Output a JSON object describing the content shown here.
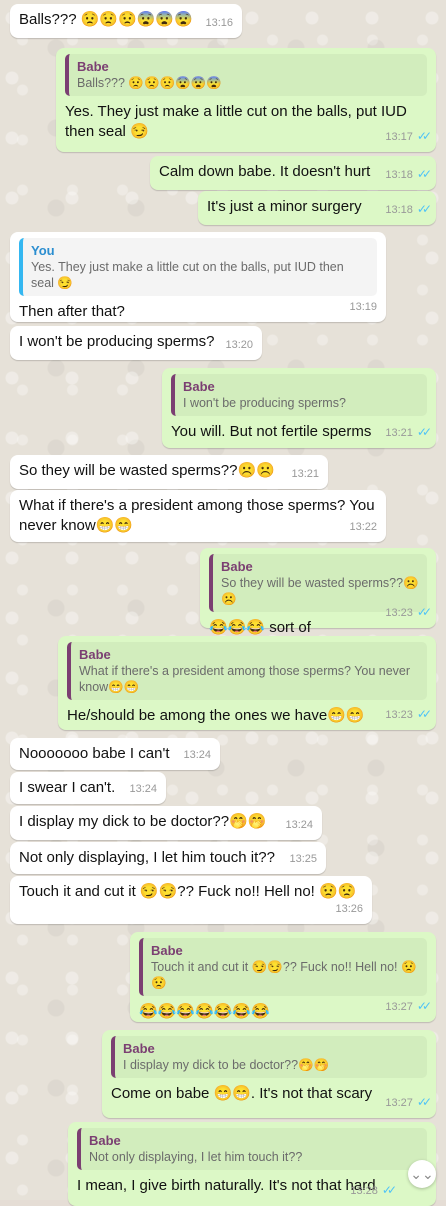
{
  "messages": {
    "m1": {
      "text": "Balls??? 😟😟😟😨😨😨",
      "time": "13:16"
    },
    "m2": {
      "quote_name": "Babe",
      "quote_text": "Balls??? 😟😟😟😨😨😨",
      "text": "Yes. They just make a little cut on the balls, put IUD then seal 😏",
      "time": "13:17"
    },
    "m3": {
      "text": "Calm down babe. It doesn't hurt",
      "time": "13:18"
    },
    "m4": {
      "text": "It's just a minor surgery",
      "time": "13:18"
    },
    "m5": {
      "quote_name": "You",
      "quote_text": "Yes. They just make a little cut on the balls, put IUD then seal 😏",
      "text": "Then after that?",
      "time": "13:19"
    },
    "m6": {
      "text": "I won't be producing sperms?",
      "time": "13:20"
    },
    "m7": {
      "quote_name": "Babe",
      "quote_text": "I won't be producing sperms?",
      "text": "You will. But not fertile sperms",
      "time": "13:21"
    },
    "m8": {
      "text": "So they will be wasted sperms??☹️☹️",
      "time": "13:21"
    },
    "m9": {
      "text": "What if there's a president among those sperms? You never know😁😁",
      "time": "13:22"
    },
    "m10": {
      "quote_name": "Babe",
      "quote_text": "So they will be wasted sperms??☹️☹️",
      "text": "😂😂😂 sort of",
      "time": "13:23"
    },
    "m11": {
      "quote_name": "Babe",
      "quote_text": "What if there's a president among those sperms? You never know😁😁",
      "text": "He/should be among the ones we have😁😁",
      "time": "13:23"
    },
    "m12": {
      "text": "Nooooooo babe I can't",
      "time": "13:24"
    },
    "m13": {
      "text": "I swear I can't.",
      "time": "13:24"
    },
    "m14": {
      "text": "I display my dick to be doctor??🤭🤭",
      "time": "13:24"
    },
    "m15": {
      "text": "Not only displaying, I let him touch it??",
      "time": "13:25"
    },
    "m16": {
      "text": "Touch it and cut it 😏😏?? Fuck no!! Hell no! 😟😟",
      "time": "13:26"
    },
    "m17": {
      "quote_name": "Babe",
      "quote_text": "Touch it and cut it 😏😏?? Fuck no!! Hell no! 😟😟",
      "text": "😂😂😂😂😂😂😂",
      "time": "13:27"
    },
    "m18": {
      "quote_name": "Babe",
      "quote_text": "I display my dick to be doctor??🤭🤭",
      "text": "Come on babe 😁😁. It's not that scary",
      "time": "13:27"
    },
    "m19": {
      "quote_name": "Babe",
      "quote_text": "Not only displaying, I let him touch it??",
      "text": "I mean, I give birth naturally. It's not that hard",
      "time": "13:28"
    }
  },
  "ticks": "✓✓",
  "scroll_icon": "⌄⌄",
  "colors": {
    "incoming": "#ffffff",
    "outgoing": "#dcf8c6",
    "quote_bar": "#7b3f72",
    "quote_bar_you": "#34b7f1",
    "read_ticks": "#4fc3f7"
  }
}
